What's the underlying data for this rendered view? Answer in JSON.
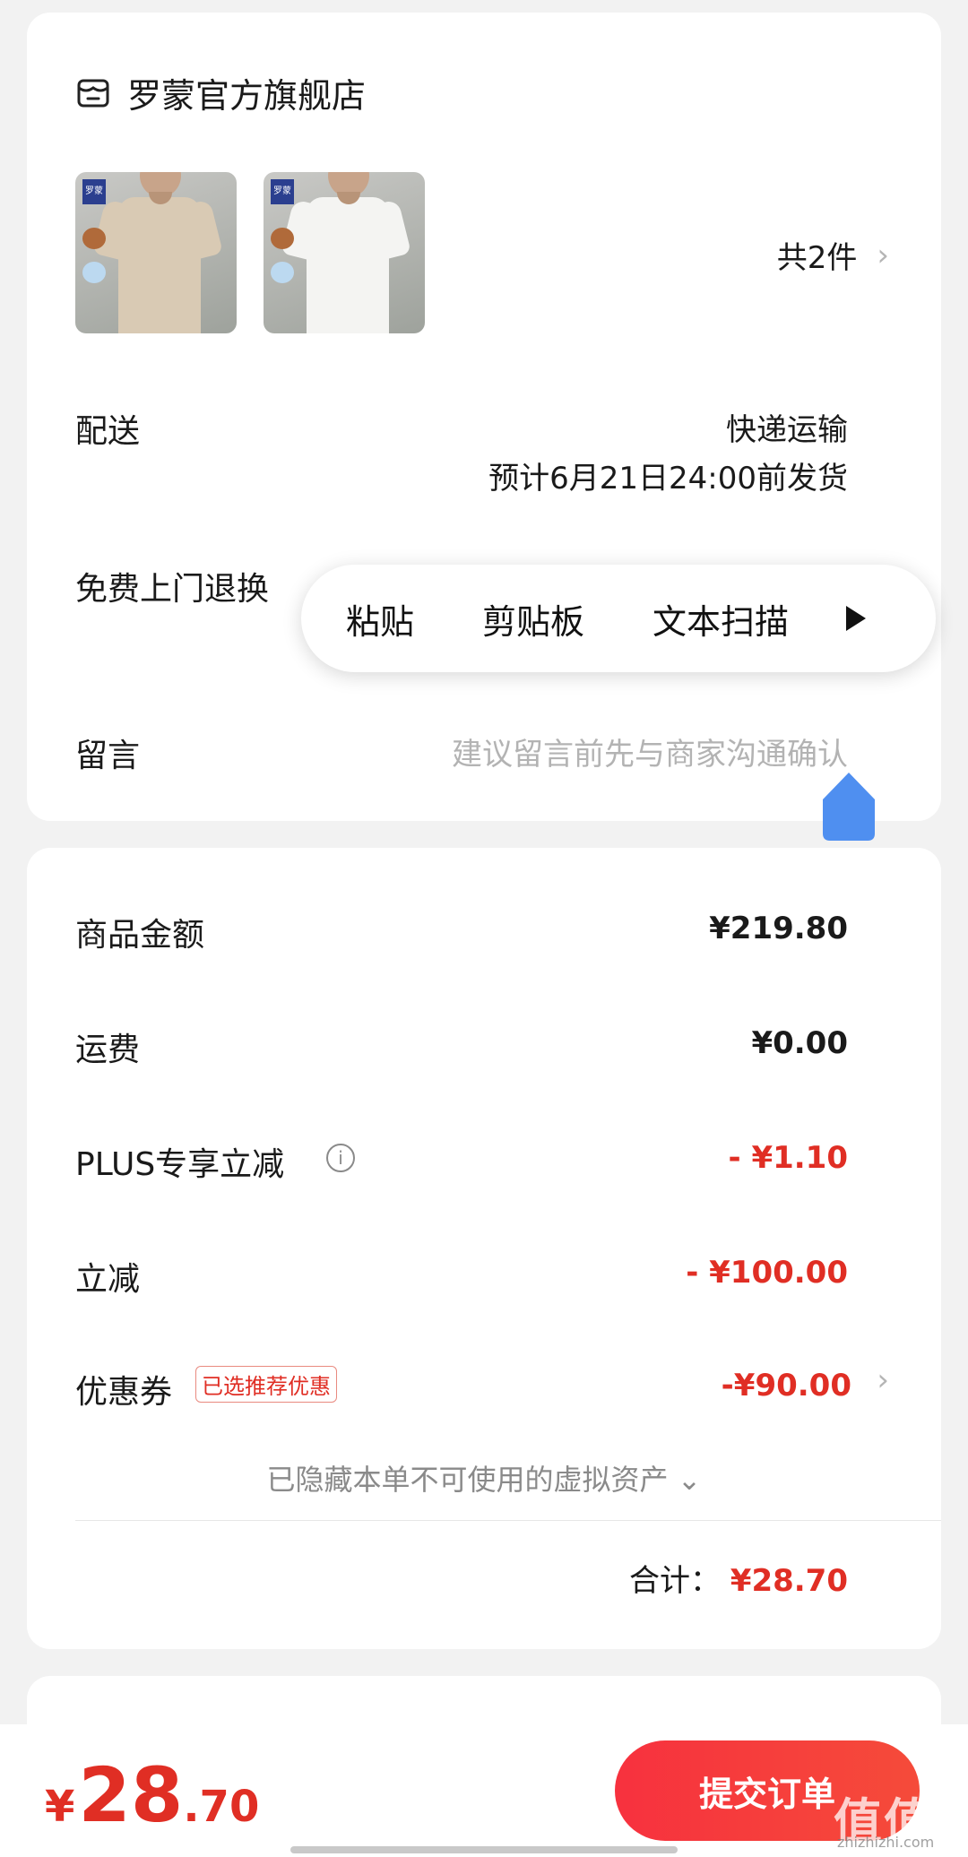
{
  "store": {
    "name": "罗蒙官方旗舰店",
    "item_count": "共2件",
    "thumb_brand": "罗蒙"
  },
  "delivery": {
    "label": "配送",
    "method": "快递运输",
    "eta": "预计6月21日24:00前发货"
  },
  "return_service": {
    "label": "免费上门退换"
  },
  "context_menu": {
    "items": [
      "粘贴",
      "剪贴板",
      "文本扫描"
    ]
  },
  "message": {
    "label": "留言",
    "placeholder": "建议留言前先与商家沟通确认"
  },
  "pricing": {
    "goods_label": "商品金额",
    "goods_value": "¥219.80",
    "shipping_label": "运费",
    "shipping_value": "¥0.00",
    "plus_label": "PLUS专享立减",
    "plus_value": "- ¥1.10",
    "discount_label": "立减",
    "discount_value": "- ¥100.00",
    "coupon_label": "优惠券",
    "coupon_tag": "已选推荐优惠",
    "coupon_value": "-¥90.00",
    "hidden_assets": "已隐藏本单不可使用的虚拟资产 ⌄",
    "total_label": "合计：",
    "total_value": "¥28.70"
  },
  "bottom_bar": {
    "currency": "¥",
    "amount_int": "28",
    "amount_dec": ".70",
    "submit_label": "提交订单"
  },
  "watermark": {
    "text": "值值值",
    "sub": "zhizhizhi.com"
  },
  "colors": {
    "accent_red": "#e02e24",
    "cursor_blue": "#4f8ff0",
    "background": "#f2f2f2"
  }
}
